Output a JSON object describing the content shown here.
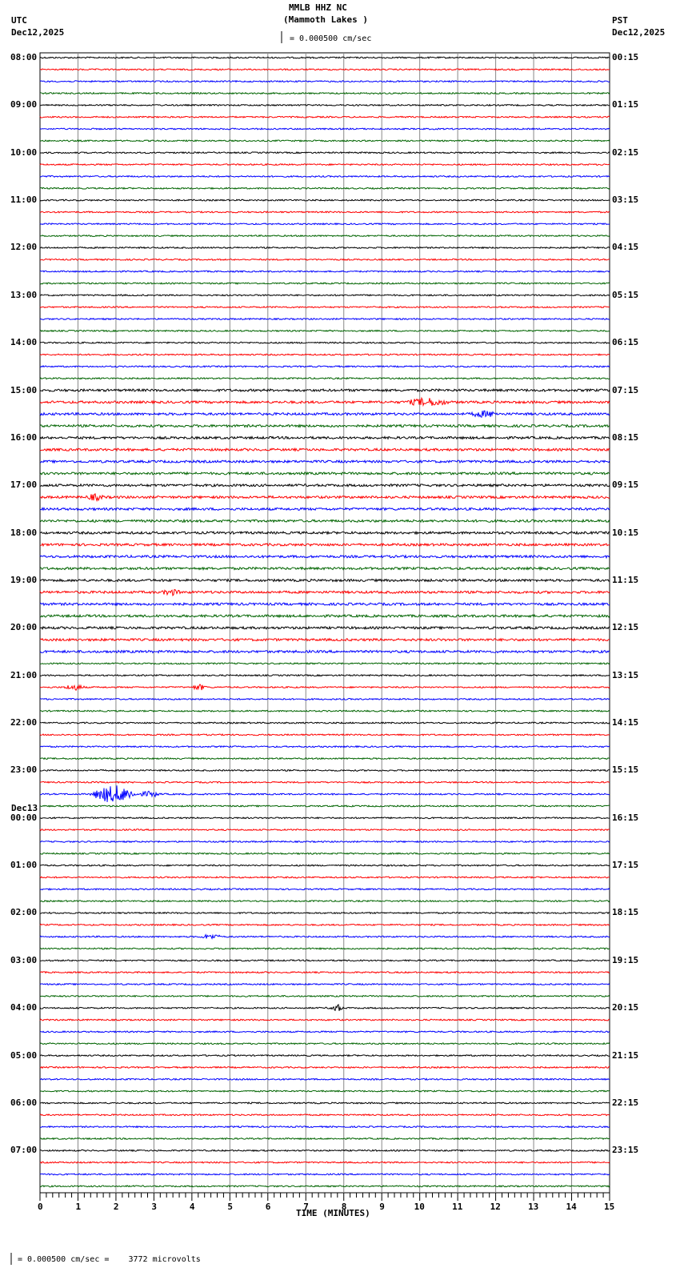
{
  "header": {
    "station": "MMLB HHZ NC",
    "location": "(Mammoth Lakes )",
    "scale": "= 0.000500 cm/sec",
    "left_tz": "UTC",
    "left_date": "Dec12,2025",
    "right_tz": "PST",
    "right_date": "Dec12,2025",
    "next_day_label": "Dec13"
  },
  "footer": {
    "scale_note": "= 0.000500 cm/sec =    3772 microvolts"
  },
  "colors": {
    "trace_cycle": [
      "#000000",
      "#ff0000",
      "#0000ff",
      "#006400"
    ],
    "grid": "#888888"
  },
  "chart_data": {
    "type": "line",
    "title": "MMLB HHZ NC (Mammoth Lakes )",
    "xlabel": "TIME (MINUTES)",
    "xlim": [
      0,
      15
    ],
    "x_ticks": [
      "0",
      "1",
      "2",
      "3",
      "4",
      "5",
      "6",
      "7",
      "8",
      "9",
      "10",
      "11",
      "12",
      "13",
      "14",
      "15"
    ],
    "traces_per_hour": 4,
    "trace_count": 96,
    "left_labels": [
      "08:00",
      "09:00",
      "10:00",
      "11:00",
      "12:00",
      "13:00",
      "14:00",
      "15:00",
      "16:00",
      "17:00",
      "18:00",
      "19:00",
      "20:00",
      "21:00",
      "22:00",
      "23:00",
      "00:00",
      "01:00",
      "02:00",
      "03:00",
      "04:00",
      "05:00",
      "06:00",
      "07:00"
    ],
    "right_labels": [
      "00:15",
      "01:15",
      "02:15",
      "03:15",
      "04:15",
      "05:15",
      "06:15",
      "07:15",
      "08:15",
      "09:15",
      "10:15",
      "11:15",
      "12:15",
      "13:15",
      "14:15",
      "15:15",
      "16:15",
      "17:15",
      "18:15",
      "19:15",
      "20:15",
      "21:15",
      "22:15",
      "23:15"
    ],
    "events": [
      {
        "trace": 29,
        "start_min": 9.6,
        "duration_min": 1.2,
        "amplitude": 4
      },
      {
        "trace": 30,
        "start_min": 11.3,
        "duration_min": 0.8,
        "amplitude": 3
      },
      {
        "trace": 62,
        "start_min": 1.3,
        "duration_min": 1.3,
        "amplitude": 10
      },
      {
        "trace": 62,
        "start_min": 2.6,
        "duration_min": 0.6,
        "amplitude": 3
      },
      {
        "trace": 80,
        "start_min": 7.6,
        "duration_min": 0.4,
        "amplitude": 4
      },
      {
        "trace": 53,
        "start_min": 0.6,
        "duration_min": 0.6,
        "amplitude": 3
      },
      {
        "trace": 53,
        "start_min": 4.0,
        "duration_min": 0.4,
        "amplitude": 3
      },
      {
        "trace": 37,
        "start_min": 1.2,
        "duration_min": 0.5,
        "amplitude": 3
      },
      {
        "trace": 45,
        "start_min": 3.2,
        "duration_min": 0.5,
        "amplitude": 3
      },
      {
        "trace": 74,
        "start_min": 4.2,
        "duration_min": 0.6,
        "amplitude": 2.5
      }
    ]
  }
}
